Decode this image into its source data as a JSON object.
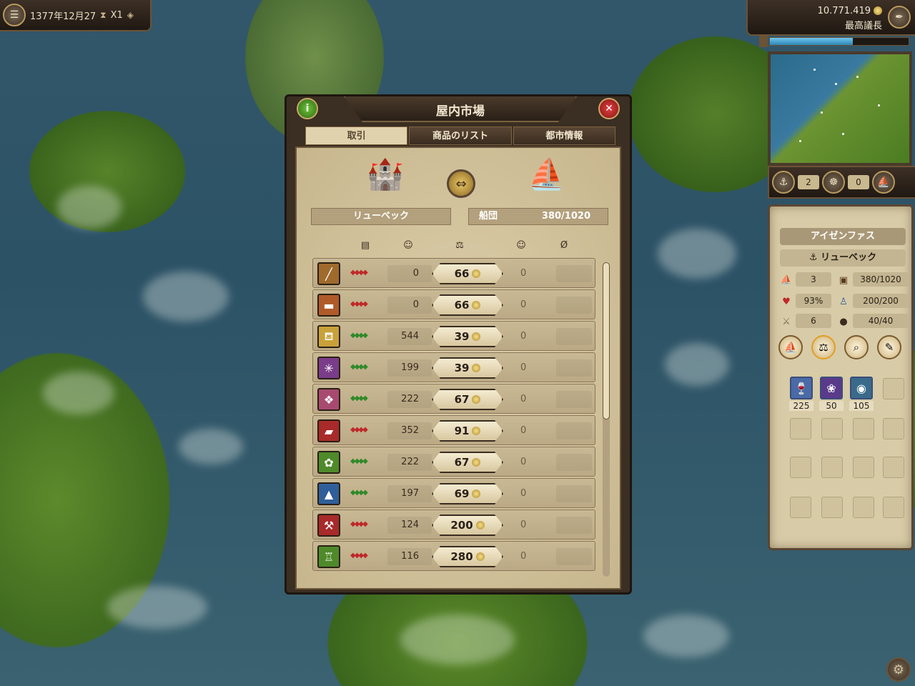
{
  "top_left": {
    "date": "1377年12月27",
    "speed": "X1"
  },
  "top_right": {
    "money": "10.771.419",
    "title": "最高議長"
  },
  "fleet_bar": {
    "convoys": "2",
    "ships": "0"
  },
  "ship_panel": {
    "ship_name": "アイゼンファス",
    "location": "リューベック",
    "stats": {
      "ships": "3",
      "cargo": "380/1020",
      "condition": "93%",
      "sailors": "200/200",
      "weapons": "6",
      "cannons": "40/40"
    },
    "cargo": [
      {
        "icon": "wine-icon",
        "qty": "225"
      },
      {
        "icon": "grape-icon",
        "qty": "50"
      },
      {
        "icon": "honey-icon",
        "qty": "105"
      }
    ]
  },
  "market": {
    "title": "屋内市場",
    "tabs": [
      "取引",
      "商品のリスト",
      "都市情報"
    ],
    "active_tab": 0,
    "city_label": "リューベック",
    "fleet_label": "船団",
    "fleet_capacity": "380/1020",
    "colors": {
      "red": "#c0282a",
      "green": "#2f8a2a"
    },
    "goods": [
      {
        "icon": "timber-icon",
        "color": "#a06a2c",
        "trend": "red",
        "stock": "0",
        "price": "66",
        "ship": "0"
      },
      {
        "icon": "brick-icon",
        "color": "#b05a2a",
        "trend": "red",
        "stock": "0",
        "price": "66",
        "ship": "0"
      },
      {
        "icon": "beer-icon",
        "color": "#c9a13a",
        "trend": "green",
        "stock": "544",
        "price": "39",
        "ship": "0"
      },
      {
        "icon": "hemp-icon",
        "color": "#7a3d8a",
        "trend": "green",
        "stock": "199",
        "price": "39",
        "ship": "0"
      },
      {
        "icon": "cloth-icon",
        "color": "#a84a70",
        "trend": "green",
        "stock": "222",
        "price": "67",
        "ship": "0"
      },
      {
        "icon": "iron-icon",
        "color": "#a82a2a",
        "trend": "red",
        "stock": "352",
        "price": "91",
        "ship": "0"
      },
      {
        "icon": "grain-icon",
        "color": "#4f8a2a",
        "trend": "green",
        "stock": "222",
        "price": "67",
        "ship": "0"
      },
      {
        "icon": "salt-icon",
        "color": "#2f5f9a",
        "trend": "green",
        "stock": "197",
        "price": "69",
        "ship": "0"
      },
      {
        "icon": "tools-icon",
        "color": "#a82a2a",
        "trend": "red",
        "stock": "124",
        "price": "200",
        "ship": "0"
      },
      {
        "icon": "goblet-icon",
        "color": "#4f8a2a",
        "trend": "red",
        "stock": "116",
        "price": "280",
        "ship": "0"
      }
    ]
  }
}
